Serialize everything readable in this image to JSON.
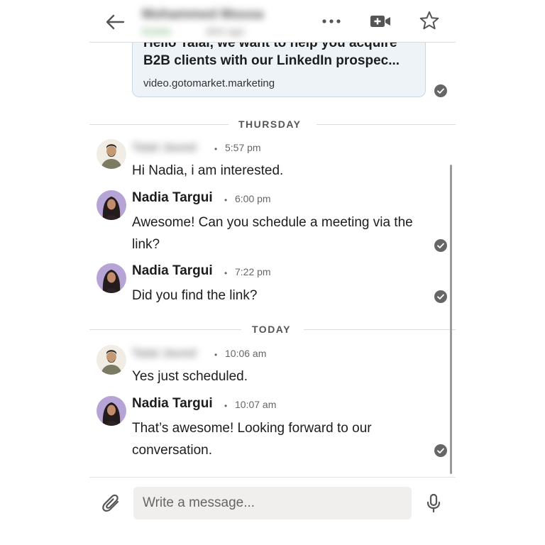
{
  "header": {
    "contact_name": "Mohammed Mousa",
    "status": "Mobile",
    "last_active": "40m ago",
    "icons": [
      "back-arrow-icon",
      "more-icon",
      "video-icon",
      "star-icon"
    ]
  },
  "link_preview": {
    "title_top_fragment": "Hello Talal, we want to help you acquire",
    "title": "B2B clients with our LinkedIn prospec...",
    "domain": "video.gotomarket.marketing"
  },
  "days": [
    {
      "label": "THURSDAY",
      "messages": [
        {
          "sender": "Talal Javed",
          "time": "5:57 pm",
          "text": "Hi Nadia, i am interested."
        },
        {
          "sender": "Nadia Targui",
          "time": "6:00 pm",
          "text": "Awesome! Can you schedule a meeting via the link?"
        },
        {
          "sender": "Nadia Targui",
          "time": "7:22 pm",
          "text": "Did you find the link?"
        }
      ]
    },
    {
      "label": "TODAY",
      "messages": [
        {
          "sender": "Talal Javed",
          "time": "10:06 am",
          "text": "Yes just scheduled."
        },
        {
          "sender": "Nadia Targui",
          "time": "10:07 am",
          "text": "That’s awesome! Looking forward to our conversation."
        }
      ]
    }
  ],
  "composer": {
    "placeholder": "Write a message...",
    "icons": [
      "paperclip-icon",
      "microphone-icon"
    ]
  },
  "colors": {
    "preview_bg": "#eef3f8",
    "receipt": "#666666",
    "composer_bg": "#f0efed"
  }
}
